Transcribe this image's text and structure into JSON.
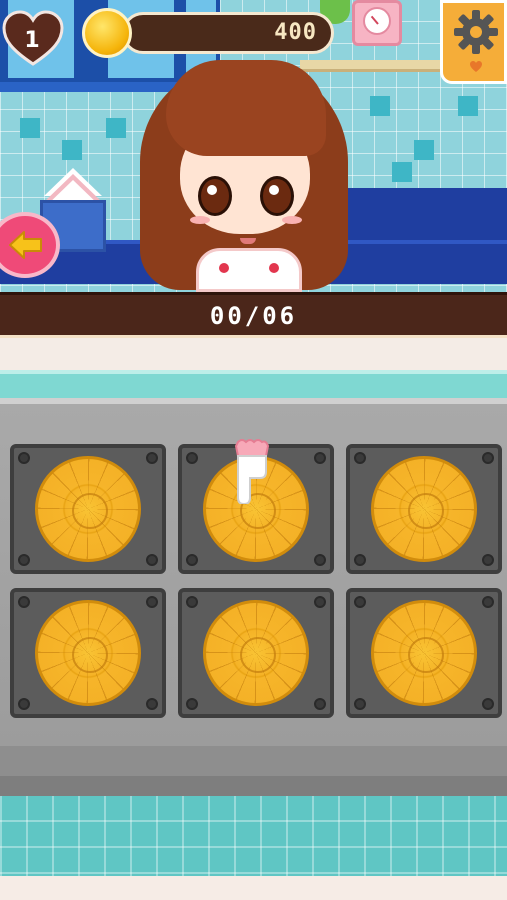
{
  "hud": {
    "lives": "1",
    "coins": "400"
  },
  "progress": {
    "text": "00/06"
  },
  "icons": {
    "lives": "heart-icon",
    "coins": "gold-coin-icon",
    "settings": "gear-icon",
    "back": "left-arrow-icon",
    "pointer": "pointing-hand-icon"
  },
  "tray": {
    "slots": [
      {
        "item": "pancake"
      },
      {
        "item": "pancake"
      },
      {
        "item": "pancake"
      },
      {
        "item": "pancake"
      },
      {
        "item": "pancake"
      },
      {
        "item": "pancake"
      }
    ]
  },
  "colors": {
    "heart": "#5a2a1d",
    "coin": "#f5b40a",
    "settings_bg": "#f5ad39",
    "back_button": "#ef4a78",
    "progress_band": "#4b261a",
    "pancake": "#f5b327"
  }
}
